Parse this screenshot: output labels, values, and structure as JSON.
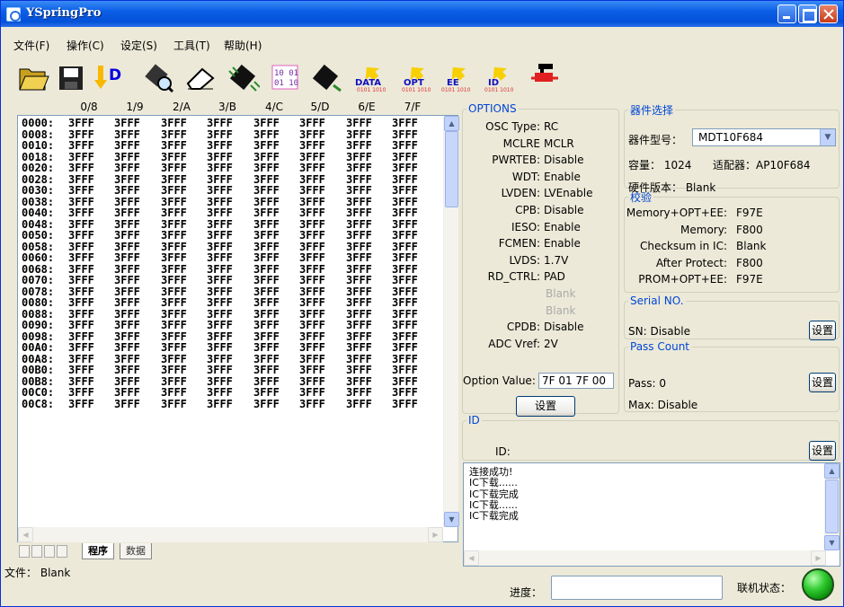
{
  "window": {
    "title": "YSpringPro"
  },
  "menu": [
    "文件(F)",
    "操作(C)",
    "设定(S)",
    "工具(T)",
    "帮助(H)"
  ],
  "toolbar": [
    {
      "icon": "open-folder-icon"
    },
    {
      "icon": "save-disk-icon"
    },
    {
      "icon": "download-arrow-icon",
      "label": "D"
    },
    {
      "icon": "search-chip-icon"
    },
    {
      "icon": "eraser-icon"
    },
    {
      "icon": "chip-icon"
    },
    {
      "icon": "binary-data-icon"
    },
    {
      "icon": "chip-write-icon"
    },
    {
      "icon": "data-icon",
      "label": "DATA"
    },
    {
      "icon": "opt-icon",
      "label": "OPT"
    },
    {
      "icon": "ee-icon",
      "label": "EE"
    },
    {
      "icon": "id-icon",
      "label": "ID"
    },
    {
      "icon": "connector-plug-icon"
    }
  ],
  "hex": {
    "columns": [
      "0/8",
      "1/9",
      "2/A",
      "3/B",
      "4/C",
      "5/D",
      "6/E",
      "7/F"
    ],
    "addresses": [
      "0000:",
      "0008:",
      "0010:",
      "0018:",
      "0020:",
      "0028:",
      "0030:",
      "0038:",
      "0040:",
      "0048:",
      "0050:",
      "0058:",
      "0060:",
      "0068:",
      "0070:",
      "0078:",
      "0080:",
      "0088:",
      "0090:",
      "0098:",
      "00A0:",
      "00A8:",
      "00B0:",
      "00B8:",
      "00C0:",
      "00C8:"
    ],
    "fill": "3FFF"
  },
  "tabs": {
    "program": "程序",
    "data": "数据"
  },
  "file": {
    "label": "文件：",
    "value": "Blank"
  },
  "options": {
    "legend": "OPTIONS",
    "items": [
      {
        "k": "OSC Type:",
        "v": "RC"
      },
      {
        "k": "MCLRE",
        "v": "MCLR"
      },
      {
        "k": "PWRTEB:",
        "v": "Disable"
      },
      {
        "k": "WDT:",
        "v": "Enable"
      },
      {
        "k": "LVDEN:",
        "v": "LVEnable"
      },
      {
        "k": "CPB:",
        "v": "Disable"
      },
      {
        "k": "IESO:",
        "v": "Enable"
      },
      {
        "k": "FCMEN:",
        "v": "Enable"
      },
      {
        "k": "LVDS:",
        "v": "1.7V"
      },
      {
        "k": "RD_CTRL:",
        "v": "PAD"
      },
      {
        "k": "",
        "v": "Blank"
      },
      {
        "k": "",
        "v": "Blank"
      },
      {
        "k": "CPDB:",
        "v": "Disable"
      },
      {
        "k": "ADC Vref:",
        "v": "2V"
      }
    ],
    "option_value_label": "Option Value:",
    "option_value": "7F 01 7F 00",
    "set_button": "设置"
  },
  "device": {
    "legend": "器件选择",
    "model_label": "器件型号：",
    "model": "MDT10F684",
    "capacity": "容量：  1024",
    "adapter": "适配器：AP10F684",
    "hw_version": "硬件版本：  Blank"
  },
  "checksum": {
    "legend": "校验",
    "rows": [
      {
        "k": "Memory+OPT+EE:",
        "v": "F97E"
      },
      {
        "k": "Memory:",
        "v": "F800"
      },
      {
        "k": "Checksum in IC:",
        "v": "Blank"
      },
      {
        "k": "After Protect:",
        "v": "F800"
      },
      {
        "k": "PROM+OPT+EE:",
        "v": "F97E"
      }
    ]
  },
  "serial": {
    "legend": "Serial NO.",
    "sn": "SN:   Disable",
    "button": "设置"
  },
  "pass": {
    "legend": "Pass Count",
    "pass": "Pass:   0",
    "max": "Max:    Disable",
    "button": "设置"
  },
  "id": {
    "legend": "ID",
    "label": "ID:",
    "button": "设置"
  },
  "log": [
    "连接成功!",
    "IC下载......",
    "IC下载完成",
    "IC下载......",
    "IC下载完成"
  ],
  "status": {
    "progress_label": "进度：",
    "progress": 0,
    "conn_label": "联机状态：",
    "conn_color": "#33cc33"
  }
}
